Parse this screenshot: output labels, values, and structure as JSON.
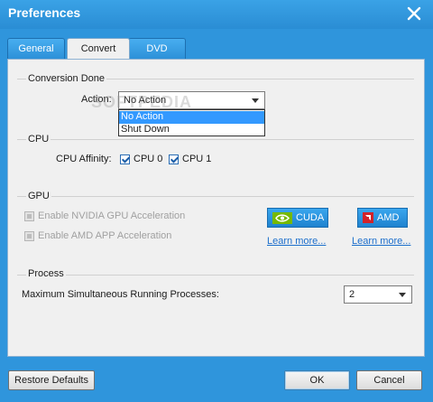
{
  "window": {
    "title": "Preferences"
  },
  "tabs": [
    {
      "label": "General"
    },
    {
      "label": "Convert"
    },
    {
      "label": "DVD"
    }
  ],
  "conversion_done": {
    "section_title": "Conversion Done",
    "action_label": "Action:",
    "action_value": "No Action",
    "options": [
      "No Action",
      "Shut Down"
    ]
  },
  "cpu": {
    "section_title": "CPU",
    "affinity_label": "CPU Affinity:",
    "cpus": [
      {
        "label": "CPU 0",
        "checked": true
      },
      {
        "label": "CPU 1",
        "checked": true
      }
    ]
  },
  "gpu": {
    "section_title": "GPU",
    "nvidia_label": "Enable NVIDIA GPU Acceleration",
    "amd_label": "Enable AMD APP Acceleration",
    "cuda_button": "CUDA",
    "amd_button": "AMD",
    "learn_more_cuda": "Learn more...",
    "learn_more_amd": "Learn more..."
  },
  "process": {
    "section_title": "Process",
    "max_label": "Maximum Simultaneous Running Processes:",
    "max_value": "2"
  },
  "watermark": "SOFTPEDIA",
  "footer": {
    "restore": "Restore Defaults",
    "ok": "OK",
    "cancel": "Cancel"
  },
  "colors": {
    "title_bar": "#2f95dc",
    "nvidia_green": "#76b900",
    "amd_red": "#d2232a",
    "selection": "#3399ff"
  }
}
